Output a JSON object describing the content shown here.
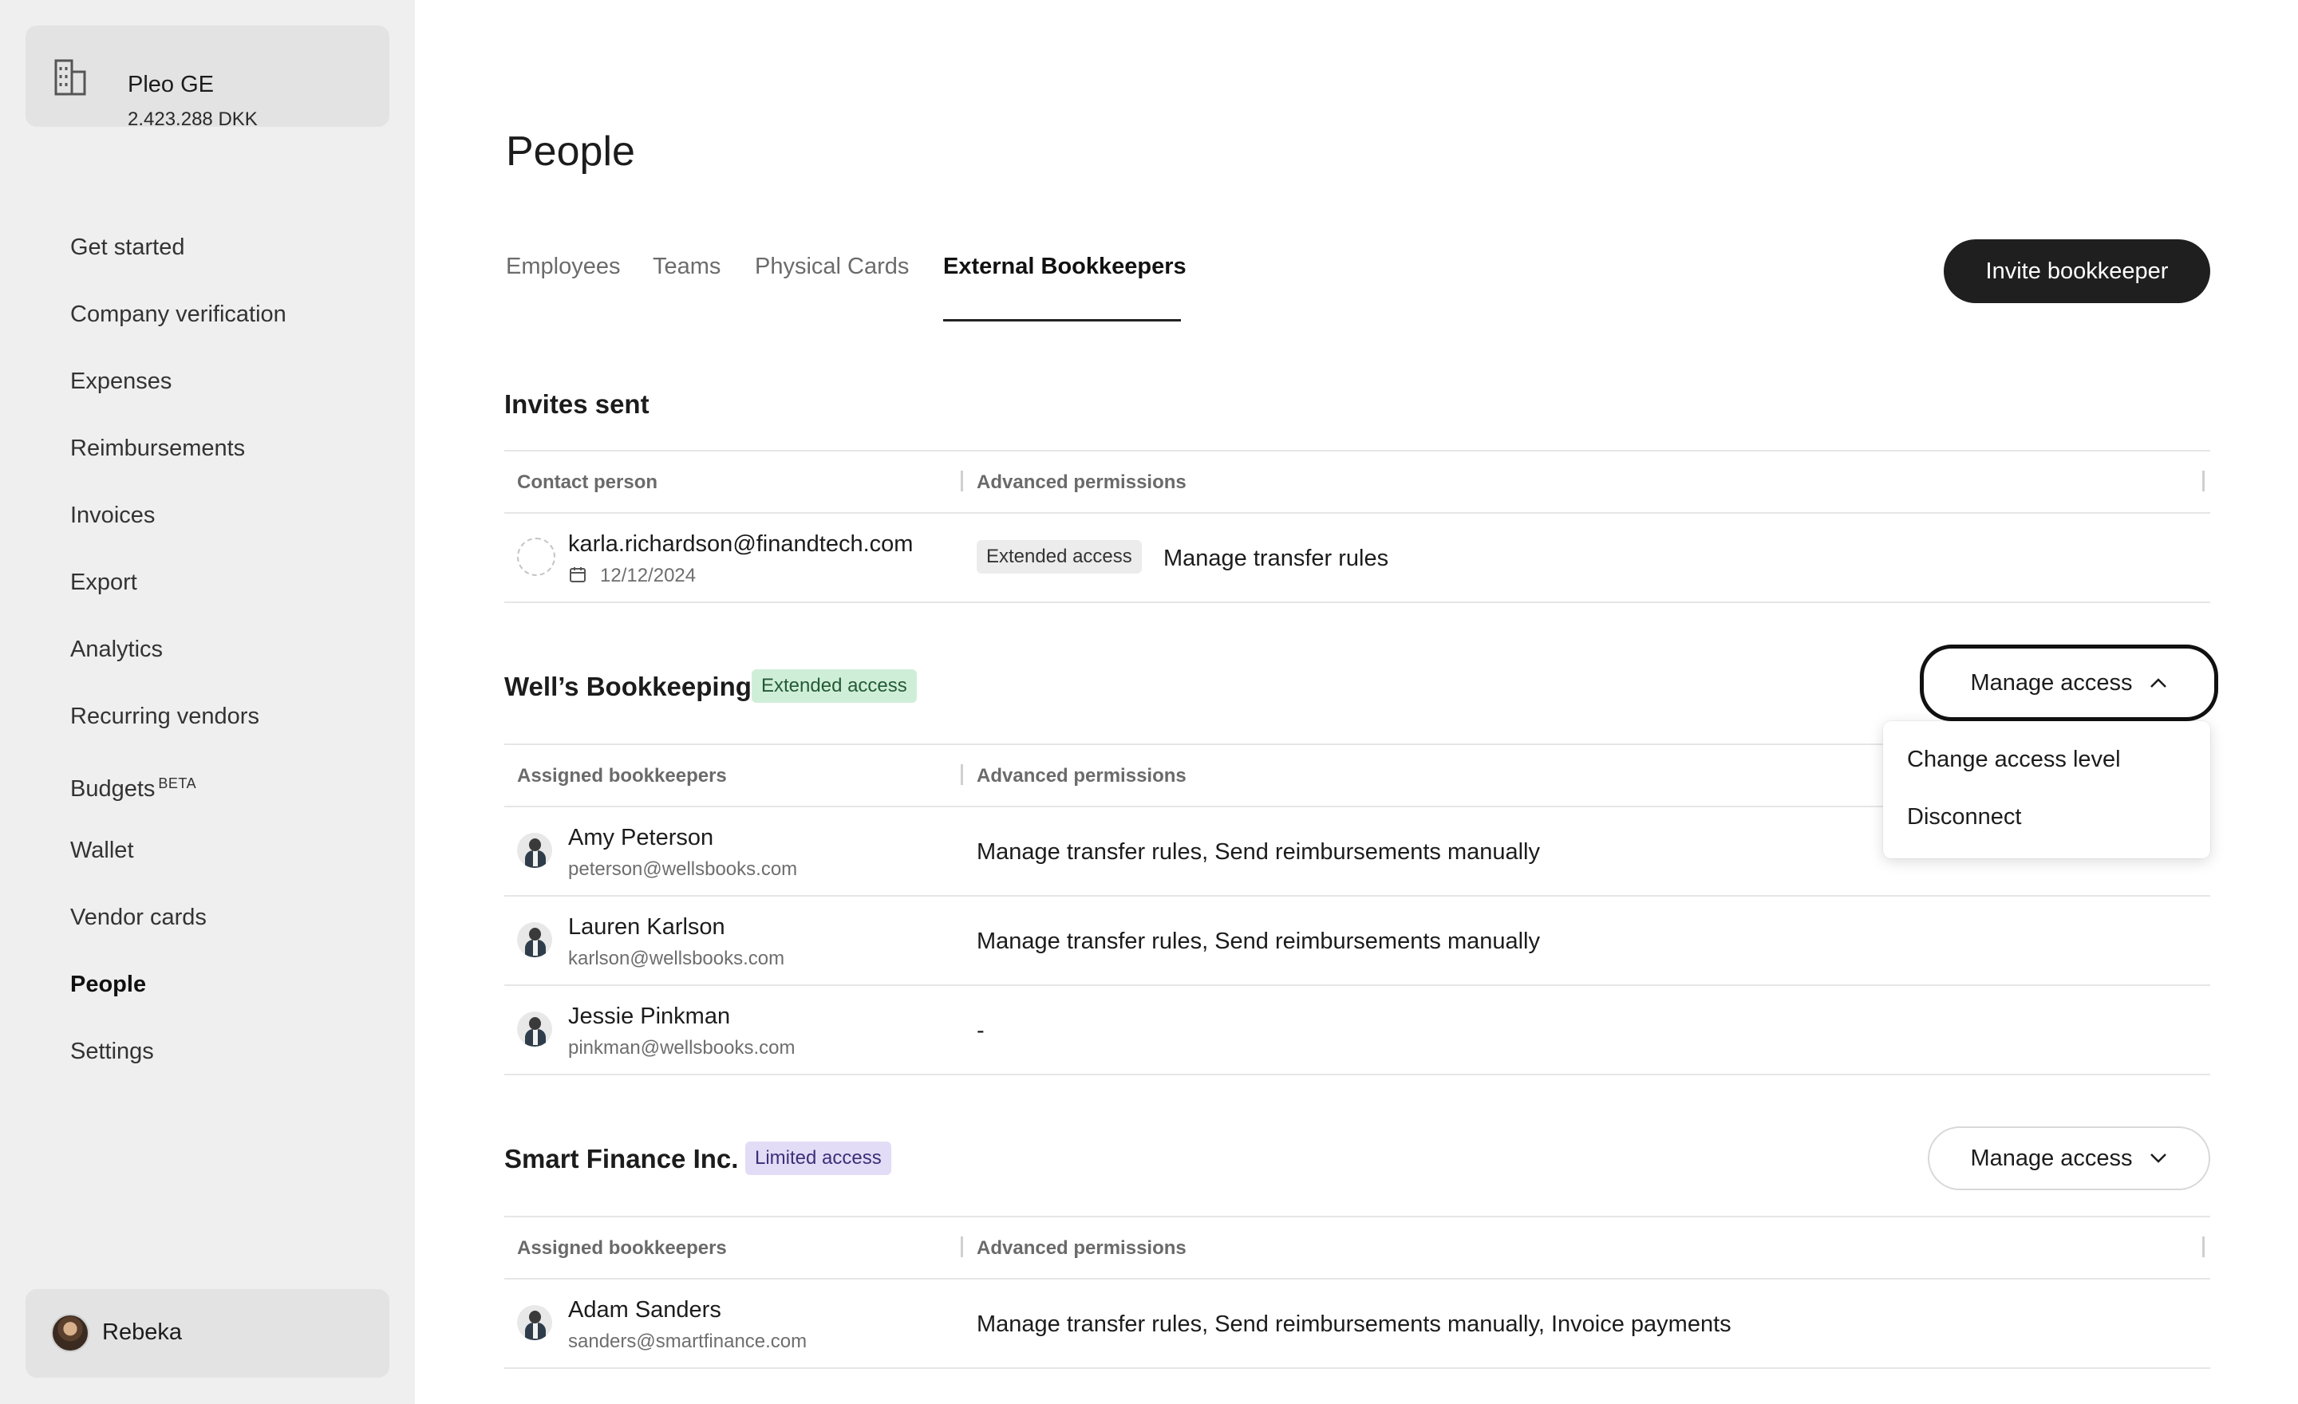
{
  "sidebar": {
    "company": {
      "name": "Pleo GE",
      "balance": "2.423.288 DKK",
      "icon": "building-icon"
    },
    "nav": [
      {
        "label": "Get started"
      },
      {
        "label": "Company verification"
      },
      {
        "label": "Expenses"
      },
      {
        "label": "Reimbursements"
      },
      {
        "label": "Invoices"
      },
      {
        "label": "Export"
      },
      {
        "label": "Analytics"
      },
      {
        "label": "Recurring vendors"
      },
      {
        "label": "Budgets",
        "badge": "BETA"
      },
      {
        "label": "Wallet"
      },
      {
        "label": "Vendor cards"
      },
      {
        "label": "People",
        "active": true
      },
      {
        "label": "Settings"
      }
    ],
    "user": {
      "name": "Rebeka"
    }
  },
  "page": {
    "title": "People",
    "tabs": [
      {
        "label": "Employees"
      },
      {
        "label": "Teams"
      },
      {
        "label": "Physical Cards"
      },
      {
        "label": "External Bookkeepers",
        "active": true
      }
    ],
    "invite_button": "Invite bookkeeper"
  },
  "invites": {
    "title": "Invites sent",
    "col_contact": "Contact person",
    "col_permissions": "Advanced permissions",
    "rows": [
      {
        "email": "karla.richardson@finandtech.com",
        "date": "12/12/2024",
        "badge": "Extended access",
        "permissions": "Manage transfer rules"
      }
    ]
  },
  "wells": {
    "title": "Well’s Bookkeeping",
    "badge": "Extended access",
    "manage_label": "Manage access",
    "col_assigned": "Assigned bookkeepers",
    "col_permissions": "Advanced permissions",
    "rows": [
      {
        "name": "Amy Peterson",
        "email": "peterson@wellsbooks.com",
        "permissions": "Manage transfer rules, Send reimbursements manually"
      },
      {
        "name": "Lauren Karlson",
        "email": "karlson@wellsbooks.com",
        "permissions": "Manage transfer rules, Send reimbursements manually"
      },
      {
        "name": "Jessie Pinkman",
        "email": "pinkman@wellsbooks.com",
        "permissions": "-"
      }
    ],
    "dropdown": {
      "open": true,
      "items": [
        "Change access level",
        "Disconnect"
      ]
    }
  },
  "smart": {
    "title": "Smart Finance Inc.",
    "badge": "Limited access",
    "manage_label": "Manage access",
    "col_assigned": "Assigned bookkeepers",
    "col_permissions": "Advanced permissions",
    "rows": [
      {
        "name": "Adam Sanders",
        "email": "sanders@smartfinance.com",
        "permissions": "Manage transfer rules, Send reimbursements manually, Invoice payments"
      }
    ]
  },
  "colors": {
    "sidebar_bg": "#efefef",
    "primary_button": "#1f1f1f",
    "badge_extended": "#cfeed8",
    "badge_limited": "#e2dcf6"
  }
}
